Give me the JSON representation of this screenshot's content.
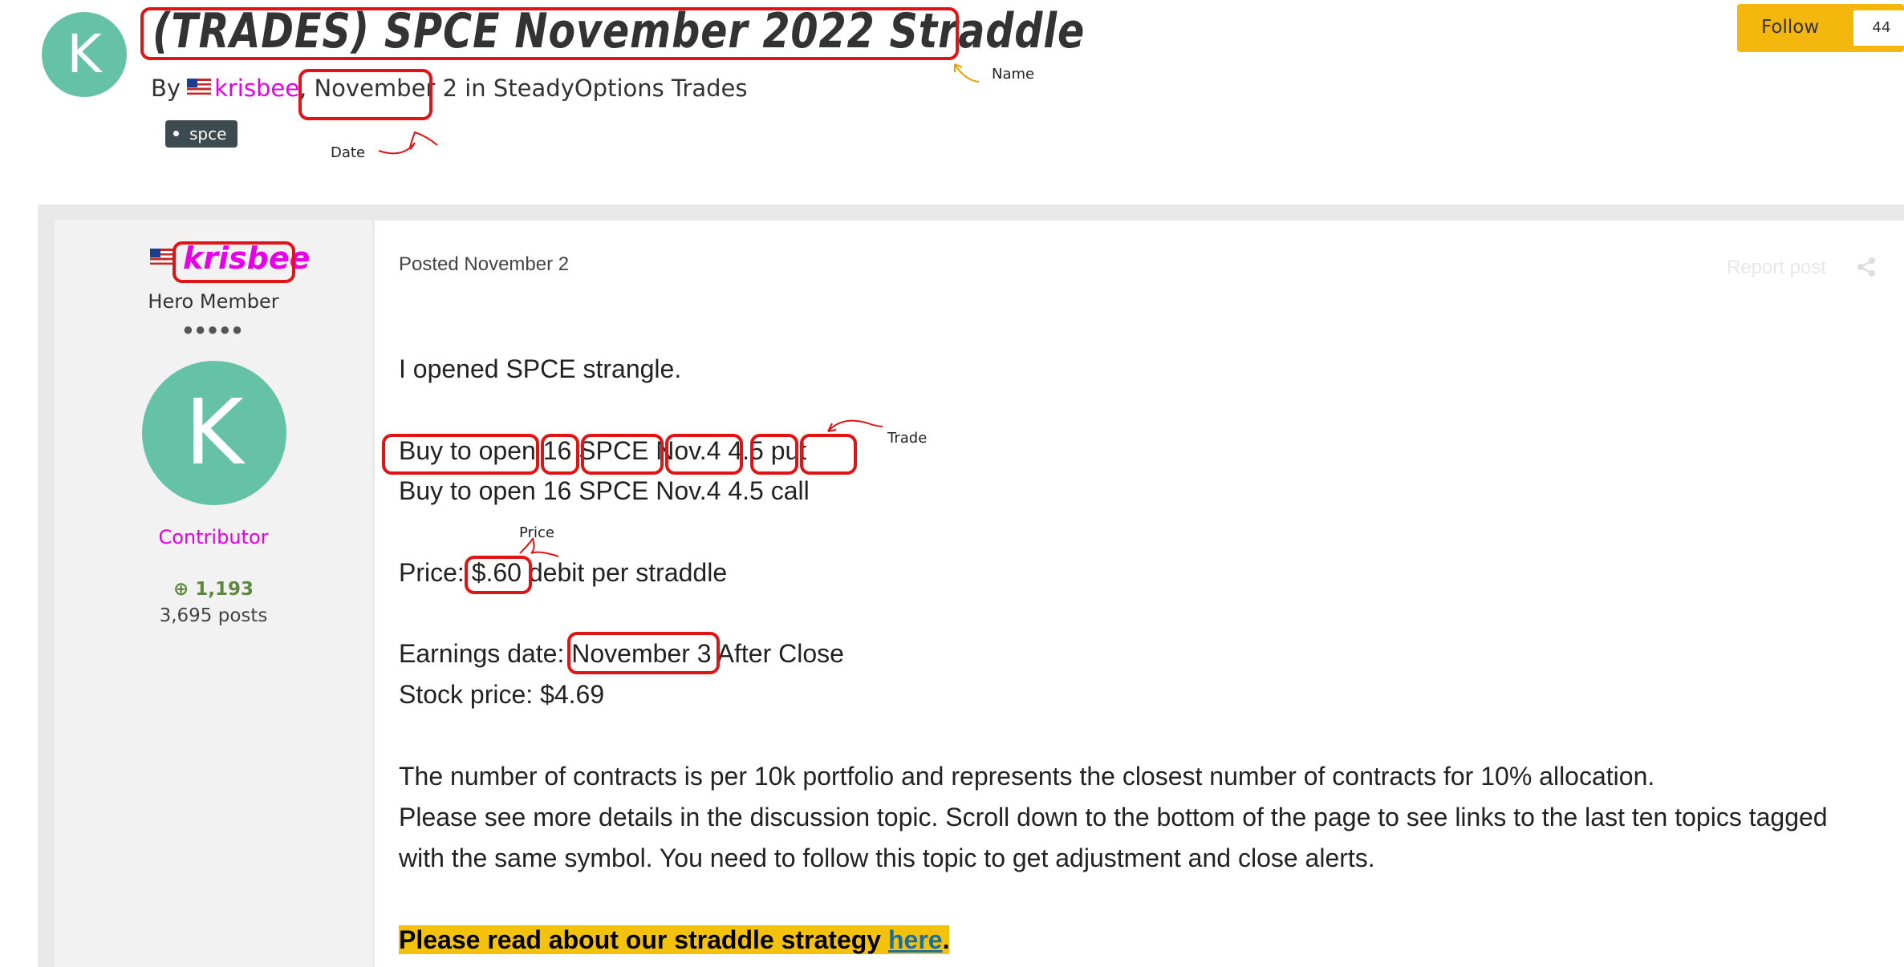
{
  "header": {
    "avatar_letter": "K",
    "title": "(TRADES) SPCE November 2022 Straddle",
    "by": "By",
    "author": "krisbee",
    "date": "November 2",
    "in_forum": "in SteadyOptions Trades",
    "tag": "spce",
    "follow_label": "Follow",
    "follow_count": "44"
  },
  "sidebar": {
    "username": "krisbee",
    "rank": "Hero Member",
    "pips": "●●●●●",
    "avatar_letter": "K",
    "group": "Contributor",
    "reputation": "1,193",
    "posts": "3,695 posts"
  },
  "post": {
    "posted": "Posted November 2",
    "report": "Report post",
    "line1": "I opened SPCE strangle.",
    "trade1": {
      "action": "Buy to open",
      "qty": "16",
      "symbol": "SPCE",
      "expiry": "Nov.4",
      "strike": "4.5",
      "type": "put"
    },
    "trade2": {
      "action": "Buy to open",
      "qty": "16",
      "symbol": "SPCE",
      "expiry": "Nov.4",
      "strike": "4.5",
      "type": "call"
    },
    "price_label": "Price:",
    "price": "$.60",
    "price_suffix": "debit per straddle",
    "earnings_label": "Earnings date:",
    "earnings_date": "November 3",
    "earnings_suffix": "After Close",
    "stock_price": "Stock price:  $4.69",
    "para1": "The number of contracts is per 10k portfolio and represents the closest number of contracts for 10% allocation.",
    "para2": "Please see more details in the discussion topic. Scroll down to the bottom of the page to see links to the last ten topics tagged",
    "para3": "with the same symbol.  You need to follow this topic to get adjustment and close alerts.",
    "strategy_text": "Please read about our straddle strategy",
    "strategy_link": "here",
    "strategy_end": "."
  },
  "annotations": {
    "name": "Name",
    "date": "Date",
    "trade": "Trade",
    "price": "Price"
  },
  "colors": {
    "avatar": "#66c2a5",
    "author": "#e600e6",
    "follow": "#f4b70e",
    "highlight": "#f4c20d",
    "annotation": "#e01414"
  }
}
